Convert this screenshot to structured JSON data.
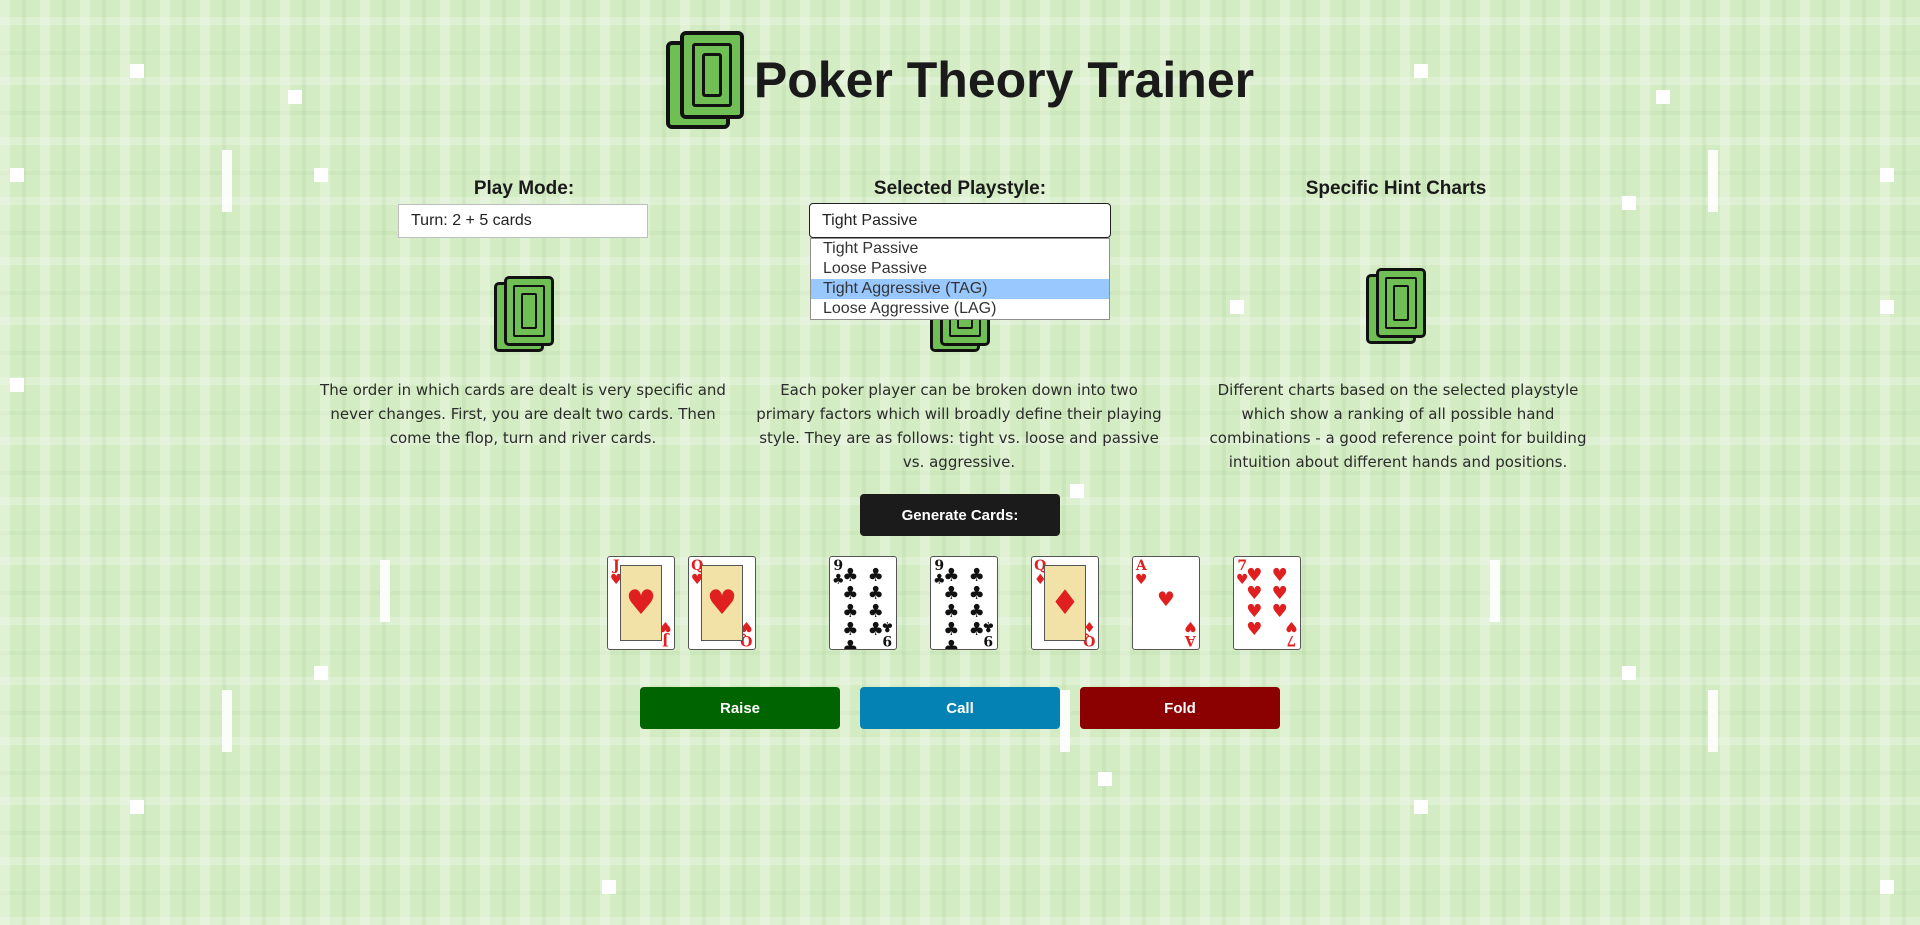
{
  "app": {
    "title": "Poker Theory Trainer"
  },
  "play_mode": {
    "label": "Play Mode:",
    "value": "Turn: 2 + 5 cards",
    "description": "The order in which cards are dealt is very specific and never changes. First, you are dealt two cards. Then come the flop, turn and river cards."
  },
  "playstyle": {
    "label": "Selected Playstyle:",
    "value": "Tight Passive",
    "options": [
      "Tight Passive",
      "Loose Passive",
      "Tight Aggressive (TAG)",
      "Loose Aggressive (LAG)"
    ],
    "highlighted_option": "Tight Aggressive (TAG)",
    "description": "Each poker player can be broken down into two primary factors which will broadly define their playing style. They are as follows: tight vs. loose and passive vs. aggressive."
  },
  "hint_charts": {
    "label": "Specific Hint Charts",
    "description": "Different charts based on the selected playstyle which show a ranking of all possible hand combinations - a good reference point for building intuition about different hands and positions."
  },
  "generate": {
    "label": "Generate Cards:"
  },
  "cards": [
    {
      "rank": "J",
      "suit": "♥",
      "color": "red"
    },
    {
      "rank": "Q",
      "suit": "♥",
      "color": "red"
    },
    {
      "rank": "9",
      "suit": "♣",
      "color": "black"
    },
    {
      "rank": "9",
      "suit": "♣",
      "color": "black"
    },
    {
      "rank": "Q",
      "suit": "♦",
      "color": "red"
    },
    {
      "rank": "A",
      "suit": "♥",
      "color": "red"
    },
    {
      "rank": "7",
      "suit": "♥",
      "color": "red"
    }
  ],
  "actions": {
    "raise": "Raise",
    "call": "Call",
    "fold": "Fold"
  },
  "colors": {
    "background": "#d4ecc4",
    "logo_green": "#6fbf55",
    "generate_button": "#1b1b1b",
    "raise_button": "#006400",
    "call_button": "#0582b4",
    "fold_button": "#8b0000",
    "dropdown_highlight": "#99c8ff"
  },
  "icons": {
    "logo": "card-stack-icon"
  }
}
